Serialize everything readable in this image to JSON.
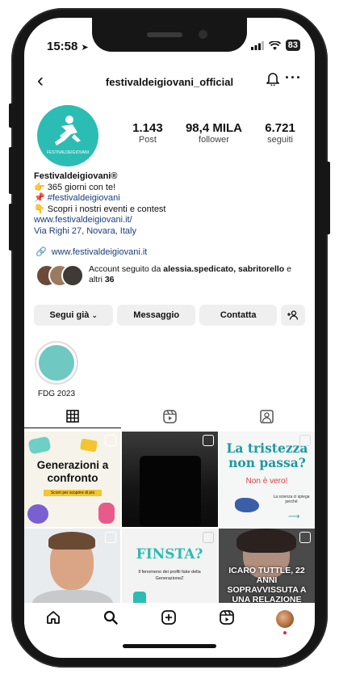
{
  "status": {
    "time": "15:58",
    "battery": "83"
  },
  "profile": {
    "username": "festivaldeigiovani_official",
    "avatar_text": "FESTIVALDEIGIOVANI",
    "stats": [
      {
        "value": "1.143",
        "label": "Post"
      },
      {
        "value": "98,4 MILA",
        "label": "follower"
      },
      {
        "value": "6.721",
        "label": "seguiti"
      }
    ],
    "name": "Festivaldeigiovani®",
    "bio": [
      "👉 365 giorni con te!",
      "📌 #festivaldeigiovani",
      "👇 Scopri i nostri eventi e contest"
    ],
    "bio_link": "www.festivaldeigiovani.it/",
    "address": "Via Righi 27, Novara, Italy",
    "external_link": "www.festivaldeigiovani.it",
    "followed_by_prefix": "Account seguito da ",
    "followed_by_names": "alessia.spedicato, sabritorello",
    "followed_by_suffix": " e altri ",
    "followed_by_count": "36"
  },
  "buttons": {
    "following": "Segui già",
    "message": "Messaggio",
    "contact": "Contatta"
  },
  "highlights": [
    {
      "label": "FDG 2023"
    }
  ],
  "posts": {
    "p1_title": "Generazioni a confronto",
    "p1_sub": "Scorri per scoprire di più",
    "p3_title": "La tristezza non passa?",
    "p3_sub": "Non è vero!",
    "p3_small": "La scienza ci spiega perché",
    "p5_title": "FINSTA?",
    "p5_sub": "Il fenomeno dei profili fake della GenerazioneZ",
    "p6_title": "ICARO TUTTLE, 22 ANNI SOPRAVVISSUTA A UNA RELAZIONE"
  },
  "colors": {
    "brand": "#2bbdb3",
    "link": "#1a3d7c",
    "button": "#efefef"
  }
}
